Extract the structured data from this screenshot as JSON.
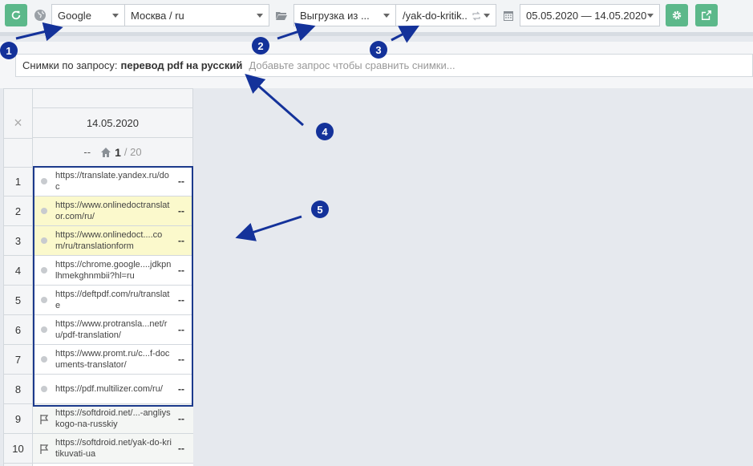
{
  "toolbar": {
    "refresh_label": "refresh",
    "search_engine": "Google",
    "region": "Москва / ru",
    "export_source": "Выгрузка из ...",
    "url_filter": "/yak-do-kritik..",
    "date_range": "05.05.2020 — 14.05.2020"
  },
  "query": {
    "label": "Снимки по запросу:",
    "term": "перевод pdf на русский",
    "hint": "Добавьте запрос чтобы сравнить снимки..."
  },
  "snapshot": {
    "date": "14.05.2020",
    "close_symbol": "×",
    "position_prev": "--",
    "position_current": "1",
    "position_total": "/ 20"
  },
  "rows": [
    {
      "num": "1",
      "url": "https://translate.yandex.ru/doc",
      "change": "--"
    },
    {
      "num": "2",
      "url": "https://www.onlinedoctranslator.com/ru/",
      "change": "--"
    },
    {
      "num": "3",
      "url": "https://www.onlinedoct....com/ru/translationform",
      "change": "--"
    },
    {
      "num": "4",
      "url": "https://chrome.google....jdkpnlhmekghnmbii?hl=ru",
      "change": "--"
    },
    {
      "num": "5",
      "url": "https://deftpdf.com/ru/translate",
      "change": "--"
    },
    {
      "num": "6",
      "url": "https://www.protransla...net/ru/pdf-translation/",
      "change": "--"
    },
    {
      "num": "7",
      "url": "https://www.promt.ru/c...f-documents-translator/",
      "change": "--"
    },
    {
      "num": "8",
      "url": "https://pdf.multilizer.com/ru/",
      "change": "--"
    },
    {
      "num": "9",
      "url": "https://softdroid.net/...-angliyskogo-na-russkiy",
      "change": "--"
    },
    {
      "num": "10",
      "url": "https://softdroid.net/yak-do-kritikuvati-ua",
      "change": "--"
    }
  ],
  "callouts": [
    "1",
    "2",
    "3",
    "4",
    "5"
  ],
  "colors": {
    "accent_green": "#5cb88a",
    "callout_blue": "#14329a",
    "highlight_yellow": "#fbf9cc"
  }
}
